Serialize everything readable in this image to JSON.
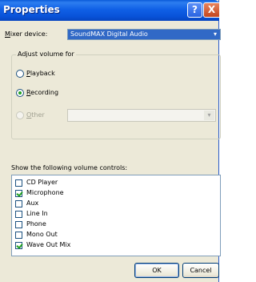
{
  "window": {
    "title": "Properties",
    "help_glyph": "?",
    "close_glyph": "X"
  },
  "mixer": {
    "label_prefix": "M",
    "label_rest": "ixer device:",
    "selected": "SoundMAX Digital Audio",
    "arrow": "▾"
  },
  "adjust": {
    "legend": "Adjust volume for",
    "options": [
      {
        "accel": "P",
        "rest": "layback",
        "checked": false,
        "enabled": true
      },
      {
        "accel": "R",
        "rest": "ecording",
        "checked": true,
        "enabled": true
      },
      {
        "accel": "O",
        "rest": "ther",
        "checked": false,
        "enabled": false
      }
    ],
    "other_arrow": "▾"
  },
  "controls": {
    "heading": "Show the following volume controls:",
    "items": [
      {
        "label": "CD Player",
        "checked": false
      },
      {
        "label": "Microphone",
        "checked": true
      },
      {
        "label": "Aux",
        "checked": false
      },
      {
        "label": "Line In",
        "checked": false
      },
      {
        "label": "Phone",
        "checked": false
      },
      {
        "label": "Mono Out",
        "checked": false
      },
      {
        "label": "Wave Out Mix",
        "checked": true
      }
    ]
  },
  "buttons": {
    "ok": "OK",
    "cancel": "Cancel"
  },
  "colors": {
    "title_bar": "#0a5ad8",
    "dialog_face": "#ece9d8",
    "selection": "#3169c6",
    "check_green": "#21a121"
  }
}
